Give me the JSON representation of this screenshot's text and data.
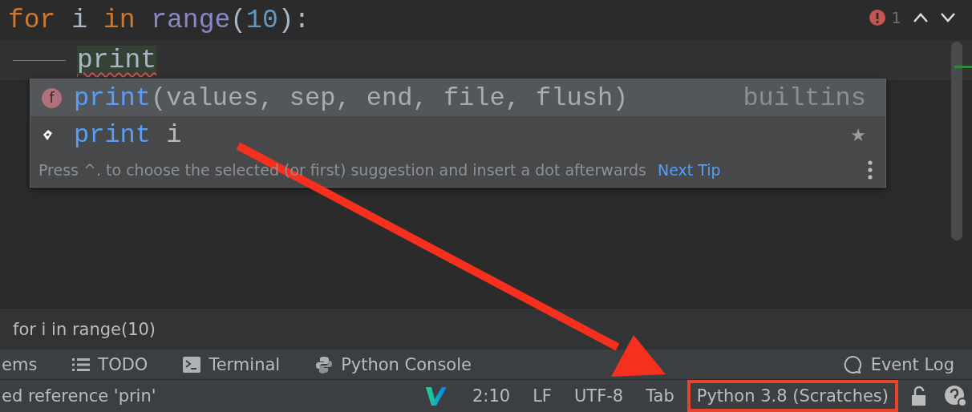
{
  "editor": {
    "problems": {
      "count": "1"
    },
    "lines": [
      {
        "current": false,
        "indent_guide": false,
        "tokens": [
          {
            "text": "for",
            "kind": "keyword"
          },
          {
            "text": " i ",
            "kind": "plain"
          },
          {
            "text": "in",
            "kind": "keyword"
          },
          {
            "text": " range",
            "kind": "builtin"
          },
          {
            "text": "(",
            "kind": "plain"
          },
          {
            "text": "10",
            "kind": "number"
          },
          {
            "text": "):",
            "kind": "plain"
          }
        ]
      },
      {
        "current": true,
        "indent_guide": true,
        "tokens": [
          {
            "text": "print",
            "kind": "error"
          }
        ]
      }
    ]
  },
  "completion": {
    "items": [
      {
        "kind": "function",
        "icon_letter": "f",
        "name": "print",
        "detail": "(values, sep, end, file, flush)",
        "source": "builtins",
        "selected": true
      },
      {
        "kind": "postfix",
        "name": "print",
        "detail": " i",
        "mark": "★",
        "selected": false
      }
    ],
    "hint": "Press ^. to choose the selected (or first) suggestion and insert a dot afterwards",
    "link": "Next Tip"
  },
  "breadcrumb": "for i in range(10)",
  "tool_windows": [
    {
      "label": "ems",
      "kind": "problems"
    },
    {
      "label": "TODO",
      "kind": "todo"
    },
    {
      "label": "Terminal",
      "kind": "terminal"
    },
    {
      "label": "Python Console",
      "kind": "console"
    }
  ],
  "event_log": "Event Log",
  "status_bar": {
    "message": "ed reference 'prin'",
    "items": [
      {
        "text": "2:10",
        "highlighted": false
      },
      {
        "text": "LF",
        "highlighted": false
      },
      {
        "text": "UTF-8",
        "highlighted": false
      },
      {
        "text": "Tab",
        "highlighted": false
      },
      {
        "text": "Python 3.8 (Scratches)",
        "highlighted": true
      }
    ]
  },
  "annotations": [
    {
      "kind": "arrow"
    }
  ]
}
